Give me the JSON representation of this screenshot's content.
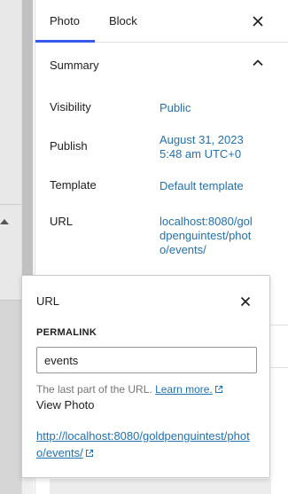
{
  "sidebar": {
    "tabs": [
      {
        "label": "Photo",
        "active": true
      },
      {
        "label": "Block",
        "active": false
      }
    ],
    "close_icon": "close-icon",
    "summary": {
      "title": "Summary",
      "toggle_icon": "chevron-up-icon",
      "rows": [
        {
          "label": "Visibility",
          "value": "Public"
        },
        {
          "label": "Publish",
          "value_line1": "August 31, 2023",
          "value_line2": "5:48 am UTC+0"
        },
        {
          "label": "Template",
          "value": "Default template"
        },
        {
          "label": "URL",
          "value": "localhost:8080/goldpenguintest/photo/events/"
        }
      ]
    }
  },
  "popover": {
    "title": "URL",
    "close_icon": "close-icon",
    "permalink_label": "PERMALINK",
    "slug_value": "events",
    "help_text": "The last part of the URL.",
    "help_link": "Learn more.",
    "view_label": "View Photo",
    "permalink_url": "http://localhost:8080/goldpenguintest/photo/events/",
    "external_icon": "external-link-icon"
  },
  "colors": {
    "accent": "#3858e9",
    "link": "#2271b1",
    "text": "#1e1e1e",
    "muted": "#757575"
  }
}
